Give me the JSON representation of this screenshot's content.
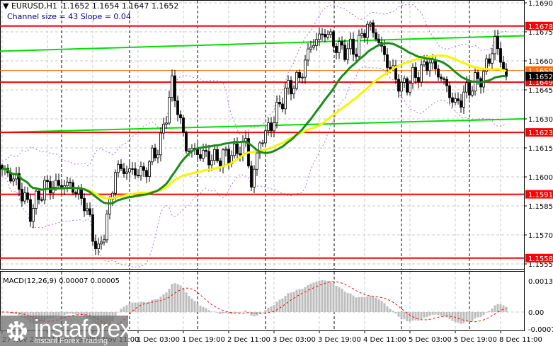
{
  "header": {
    "symbol_line": "EURUSD,H1  1.1652 1.1654 1.1647 1.1652",
    "channel_line": "Channel size = 43 Slope = 0.04"
  },
  "macd_label": "MACD(12,26,9) 0.00007 0.00005",
  "watermark": {
    "brand": "instaforex",
    "tagline": "Instant Forex Trading"
  },
  "colors": {
    "level": "#ff0000",
    "channel": "#00e000",
    "fast_ma": "#1a8c1a",
    "slow_ma": "#f5f500",
    "bands": "#b070d0",
    "orange": "#ff6a00"
  },
  "chart_data": {
    "type": "candlestick",
    "symbol": "EURUSD",
    "timeframe": "H1",
    "ylim": [
      1.1552,
      1.1692
    ],
    "price_ticks": [
      "1.1690",
      "1.1675",
      "1.1660",
      "1.1645",
      "1.1630",
      "1.1615",
      "1.1600",
      "1.1585",
      "1.1570",
      "1.1555"
    ],
    "time_labels": [
      "27 Nov 2025",
      "27 Nov 19:00",
      "28 Nov 11:00",
      "1 Dec 03:00",
      "1 Dec 19:00",
      "2 Dec 11:00",
      "3 Dec 03:00",
      "3 Dec 19:00",
      "4 Dec 11:00",
      "5 Dec 03:00",
      "5 Dec 19:00",
      "8 Dec 11:00"
    ],
    "hours_between_labels": 16,
    "price_path_keypoints": [
      [
        0,
        1.1604
      ],
      [
        5,
        1.1598
      ],
      [
        10,
        1.1582
      ],
      [
        15,
        1.1595
      ],
      [
        24,
        1.1596
      ],
      [
        29,
        1.1587
      ],
      [
        34,
        1.156
      ],
      [
        38,
        1.1585
      ],
      [
        40,
        1.1604
      ],
      [
        50,
        1.1602
      ],
      [
        56,
        1.1618
      ],
      [
        60,
        1.1648
      ],
      [
        65,
        1.1615
      ],
      [
        75,
        1.1609
      ],
      [
        83,
        1.1613
      ],
      [
        86,
        1.1618
      ],
      [
        88,
        1.1596
      ],
      [
        91,
        1.1618
      ],
      [
        95,
        1.1627
      ],
      [
        100,
        1.1644
      ],
      [
        105,
        1.1651
      ],
      [
        109,
        1.1668
      ],
      [
        114,
        1.1675
      ],
      [
        119,
        1.1666
      ],
      [
        125,
        1.1666
      ],
      [
        129,
        1.1679
      ],
      [
        132,
        1.1673
      ],
      [
        136,
        1.1659
      ],
      [
        141,
        1.1646
      ],
      [
        148,
        1.1655
      ],
      [
        151,
        1.166
      ],
      [
        156,
        1.1649
      ],
      [
        160,
        1.1637
      ],
      [
        165,
        1.1646
      ],
      [
        170,
        1.1653
      ],
      [
        174,
        1.167
      ],
      [
        178,
        1.1652
      ]
    ],
    "levels": [
      {
        "price": 1.1678,
        "label": "1.1678",
        "color": "#ff0000"
      },
      {
        "price": 1.1649,
        "label": "1.1649",
        "color": "#ff0000"
      },
      {
        "price": 1.1623,
        "label": "1.1623",
        "color": "#ff0000"
      },
      {
        "price": 1.1591,
        "label": "1.1591",
        "color": "#ff0000"
      },
      {
        "price": 1.1558,
        "label": "1.1558",
        "color": "#ff0000"
      }
    ],
    "orange_level": {
      "price": 1.1655,
      "label": "1.1655"
    },
    "current_price": {
      "price": 1.1652,
      "label": "1.1652"
    },
    "channel": {
      "upper": [
        1.1665,
        1.1673
      ],
      "lower": [
        1.1623,
        1.163
      ]
    },
    "indicators": {
      "fast_ma_period": 30,
      "slow_ma_period": 50,
      "bands_period": 20
    },
    "macd": {
      "fast": 12,
      "slow": 26,
      "signal": 9,
      "value": 7e-05,
      "signal_value": 5e-05,
      "ticks": [
        "0.00134",
        "0.00",
        "-0.00073"
      ],
      "ylim": [
        -0.0008,
        0.0015
      ]
    }
  }
}
